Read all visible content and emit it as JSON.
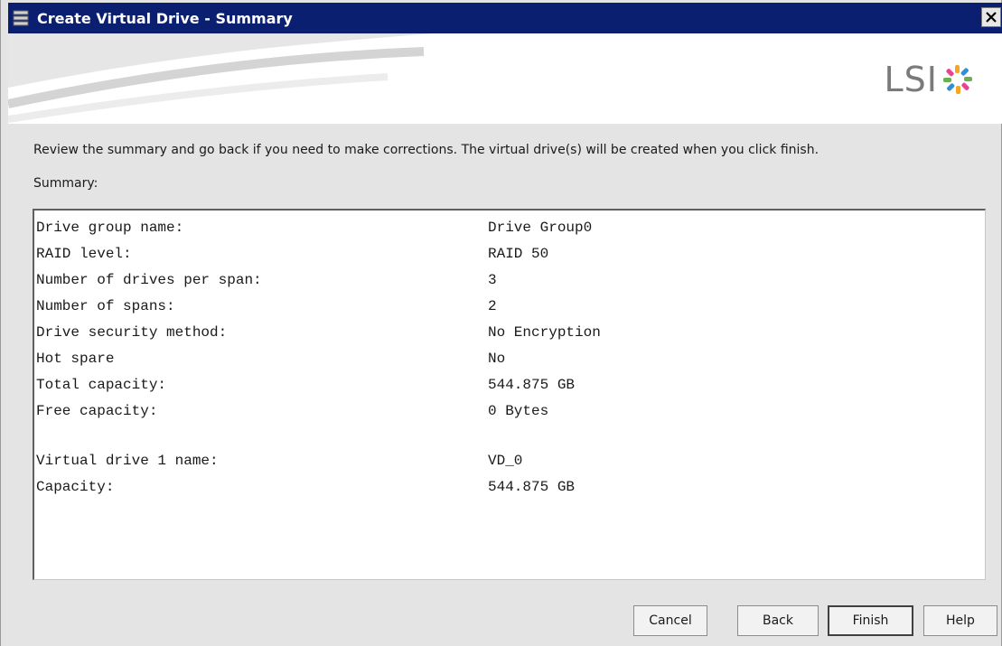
{
  "window": {
    "title": "Create Virtual Drive - Summary",
    "close_label": "×"
  },
  "banner": {
    "logo_text": "LSI",
    "logo_colors": [
      "#f5a623",
      "#2f8fd8",
      "#6ab04c",
      "#e84393"
    ]
  },
  "instruction": "Review the summary and go back if you need to make corrections. The virtual drive(s) will be created when you click finish.",
  "summary_label": "Summary:",
  "summary": {
    "rows": [
      {
        "label": "Drive group name:",
        "value": "Drive Group0"
      },
      {
        "label": "RAID level:",
        "value": "RAID 50"
      },
      {
        "label": "Number of drives per span:",
        "value": "3"
      },
      {
        "label": "Number of spans:",
        "value": "2"
      },
      {
        "label": "Drive security method:",
        "value": "No Encryption"
      },
      {
        "label": "Hot spare",
        "value": "No"
      },
      {
        "label": "Total capacity:",
        "value": "544.875 GB"
      },
      {
        "label": "Free capacity:",
        "value": "0 Bytes"
      },
      {
        "label": "",
        "value": ""
      },
      {
        "label": "Virtual drive 1 name:",
        "value": "VD_0"
      },
      {
        "label": "Capacity:",
        "value": "544.875 GB"
      }
    ]
  },
  "buttons": {
    "cancel": "Cancel",
    "back": "Back",
    "finish": "Finish",
    "help": "Help"
  }
}
